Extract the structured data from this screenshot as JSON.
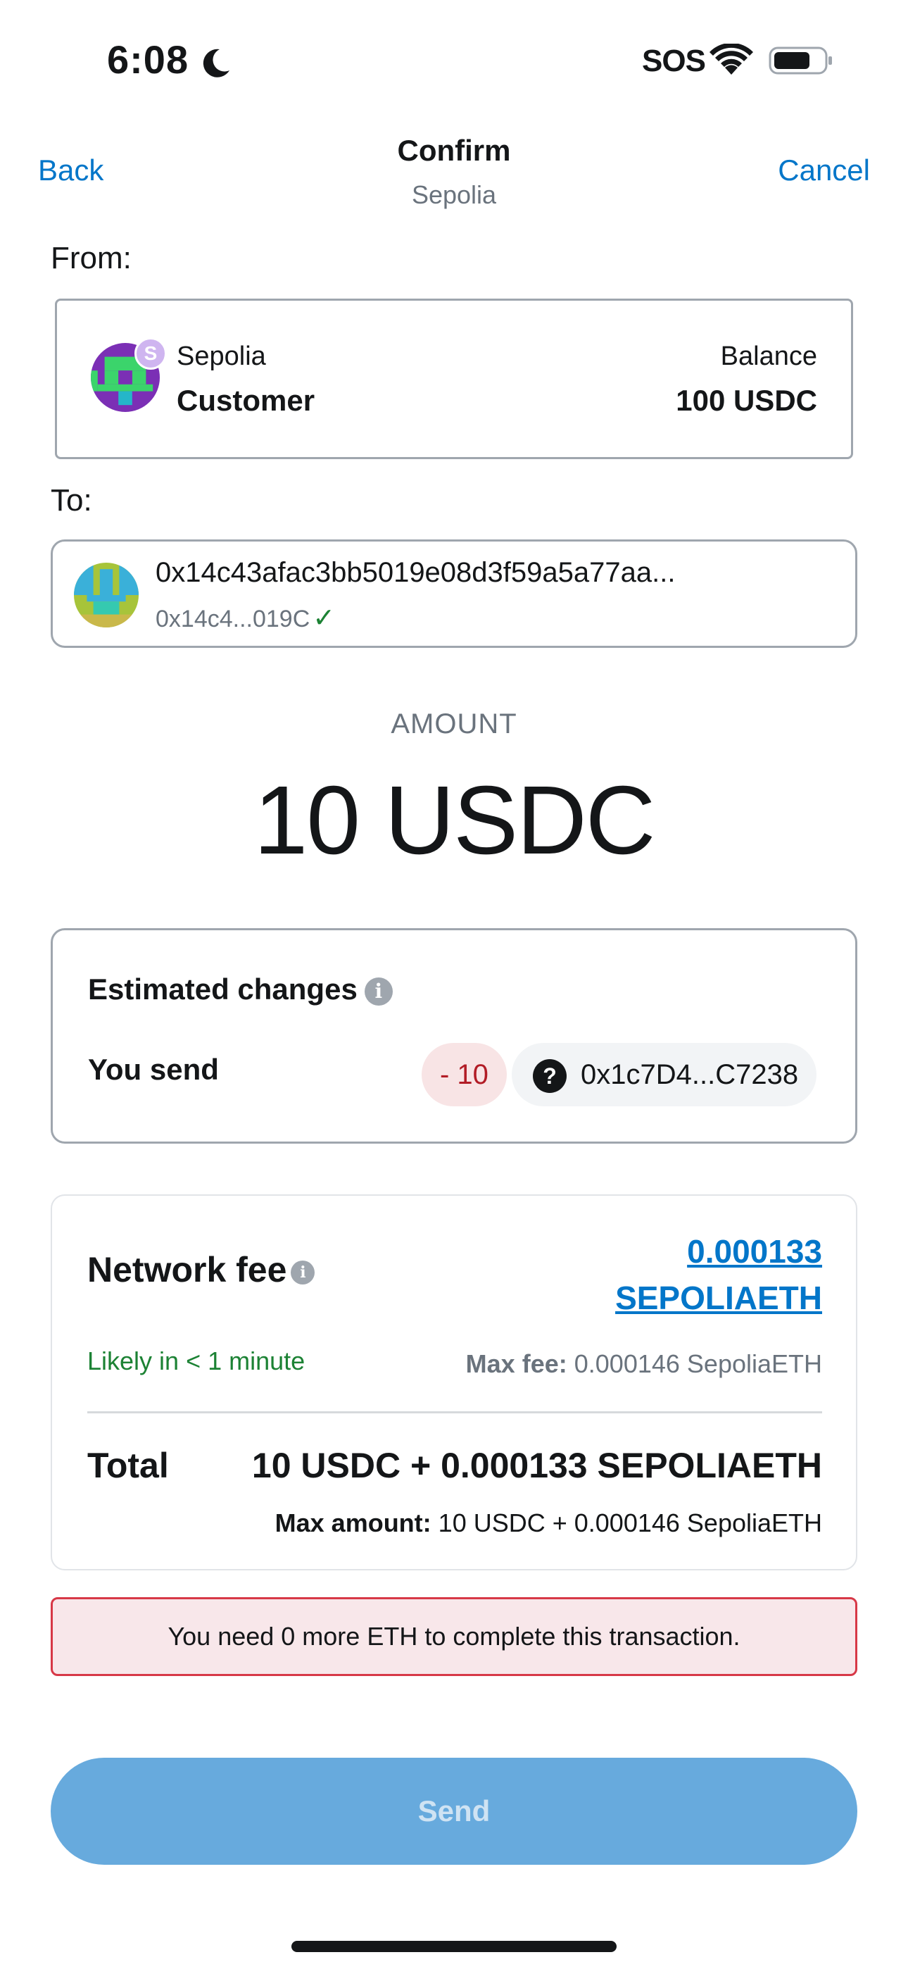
{
  "status_bar": {
    "time": "6:08",
    "sos": "SOS",
    "icons": [
      "moon-icon",
      "wifi-icon",
      "battery-icon"
    ]
  },
  "header": {
    "back_label": "Back",
    "title": "Confirm",
    "subtitle": "Sepolia",
    "cancel_label": "Cancel"
  },
  "from": {
    "label": "From:",
    "network": "Sepolia",
    "network_badge": "S",
    "account_name": "Customer",
    "balance_label": "Balance",
    "balance_value": "100 USDC"
  },
  "to": {
    "label": "To:",
    "address": "0x14c43afac3bb5019e08d3f59a5a77aa...",
    "short_address": "0x14c4...019C",
    "verified_icon": "check-icon"
  },
  "amount": {
    "label": "AMOUNT",
    "value": "10 USDC"
  },
  "estimated_changes": {
    "title": "Estimated changes",
    "you_send_label": "You send",
    "delta": "- 10",
    "token_icon_glyph": "?",
    "token_address": "0x1c7D4...C7238"
  },
  "network_fee": {
    "title": "Network fee",
    "value_line1": "0.000133",
    "value_line2": "SEPOLIAETH",
    "eta": "Likely in < 1 minute",
    "max_fee_label": "Max fee:",
    "max_fee_value": "0.000146 SepoliaETH",
    "total_label": "Total",
    "total_value": "10 USDC + 0.000133 SEPOLIAETH",
    "max_amount_label": "Max amount:",
    "max_amount_value": "10 USDC + 0.000146 SepoliaETH"
  },
  "error": {
    "message": "You need 0 more ETH to complete this transaction."
  },
  "actions": {
    "send_label": "Send"
  },
  "colors": {
    "link_blue": "#0376c9",
    "send_button_disabled": "#67aadd",
    "error_border": "#d73847",
    "error_bg": "#f8e7ea",
    "success_green": "#1c8234",
    "delta_red": "#b21c26"
  }
}
